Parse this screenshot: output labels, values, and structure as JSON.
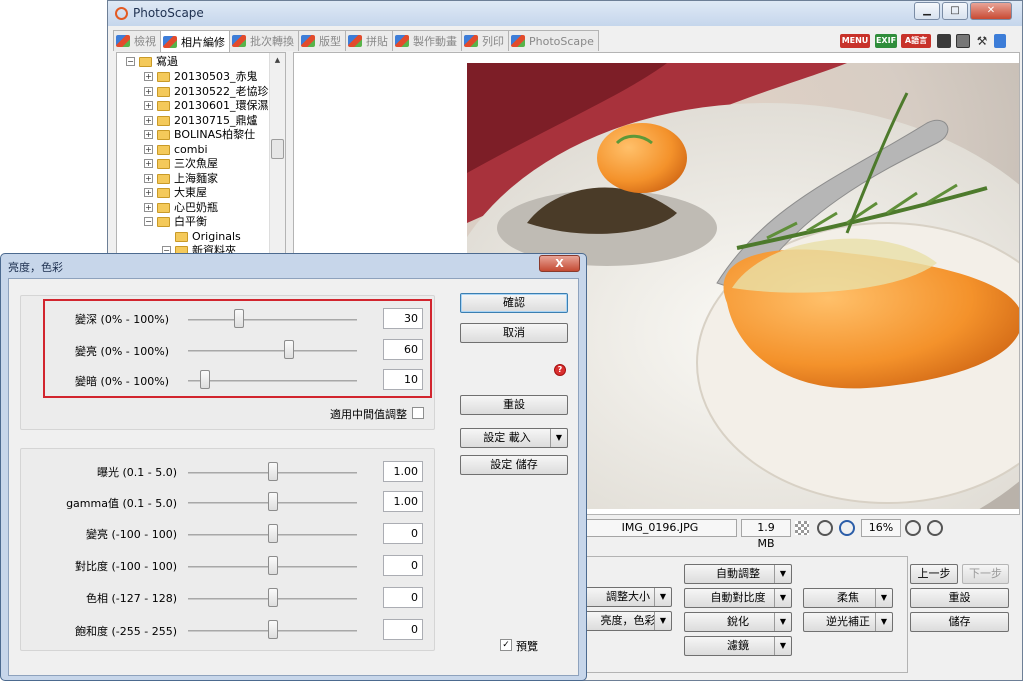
{
  "app": {
    "title": "PhotoScape"
  },
  "tabs": [
    {
      "label": "檢視"
    },
    {
      "label": "相片編修"
    },
    {
      "label": "批次轉換"
    },
    {
      "label": "版型"
    },
    {
      "label": "拼貼"
    },
    {
      "label": "製作動畫"
    },
    {
      "label": "列印"
    },
    {
      "label": "PhotoScape"
    }
  ],
  "topicons": {
    "menu": "MENU",
    "exif": "EXIF",
    "lang": "A語言"
  },
  "tree": {
    "root": "寫過",
    "items": [
      "20130503_赤鬼",
      "20130522_老協珍",
      "20130601_環保濕",
      "20130715_鼎爐",
      "BOLINAS柏黎仕",
      "combi",
      "三次魚屋",
      "上海麵家",
      "大東屋",
      "心巴奶瓶",
      "白平衡"
    ],
    "children": [
      "Originals",
      "新資料夾"
    ]
  },
  "status": {
    "filename": "IMG_0196.JPG",
    "filesize": "1.9 MB",
    "zoom": "16%"
  },
  "edit_buttons": {
    "auto_adjust": "自動調整",
    "auto_contrast": "自動對比度",
    "sharpen": "銳化",
    "filter": "濾鏡",
    "resize": "調整大小",
    "brightness": "亮度，色彩",
    "soft_focus": "柔焦",
    "backlight": "逆光補正",
    "undo": "上一步",
    "redo": "下一步",
    "reset": "重設",
    "save": "儲存"
  },
  "dialog": {
    "title": "亮度，色彩",
    "close": "X",
    "sliders_top": [
      {
        "label": "變深 (0% - 100%)",
        "value": "30",
        "pos": 0.3
      },
      {
        "label": "變亮 (0% - 100%)",
        "value": "60",
        "pos": 0.6
      },
      {
        "label": "變暗 (0% - 100%)",
        "value": "10",
        "pos": 0.1
      }
    ],
    "midtone": "適用中間值調整",
    "sliders_bottom": [
      {
        "label": "曝光 (0.1 - 5.0)",
        "value": "1.00",
        "pos": 0.5
      },
      {
        "label": "gamma值 (0.1 - 5.0)",
        "value": "1.00",
        "pos": 0.5
      },
      {
        "label": "變亮 (-100 - 100)",
        "value": "0",
        "pos": 0.5
      },
      {
        "label": "對比度 (-100 - 100)",
        "value": "0",
        "pos": 0.5
      },
      {
        "label": "色相 (-127 - 128)",
        "value": "0",
        "pos": 0.5
      },
      {
        "label": "飽和度 (-255 - 255)",
        "value": "0",
        "pos": 0.5
      }
    ],
    "ok": "確認",
    "cancel": "取消",
    "reset": "重設",
    "load": "設定 載入",
    "save": "設定 儲存",
    "preview": "預覽"
  }
}
